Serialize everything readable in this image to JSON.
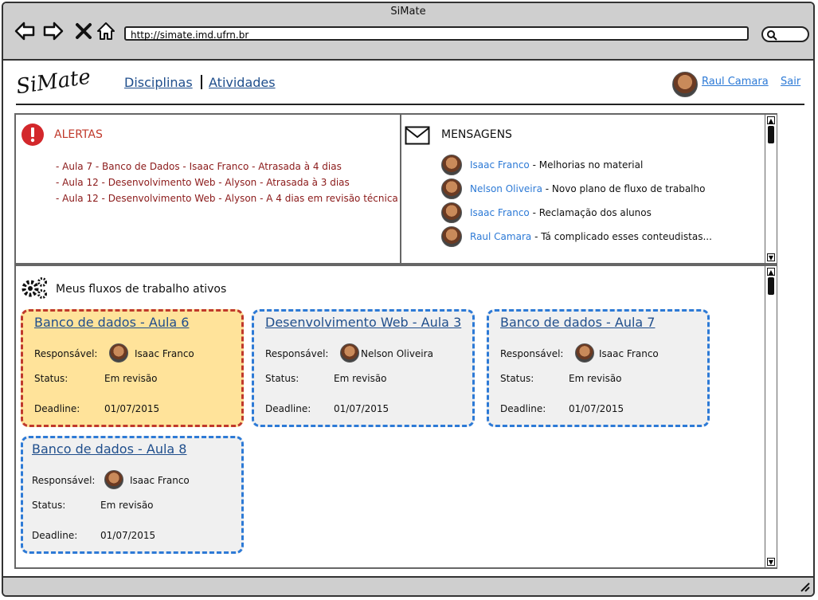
{
  "window": {
    "title": "SiMate",
    "url": "http://simate.imd.ufrn.br"
  },
  "header": {
    "logo": "SiMate",
    "nav": [
      "Disciplinas",
      "Atividades"
    ],
    "user": "Raul Camara",
    "logout": "Sair"
  },
  "alerts": {
    "title": "ALERTAS",
    "items": [
      "- Aula 7 - Banco de Dados - Isaac Franco - Atrasada à 4 dias",
      "- Aula 12 - Desenvolvimento Web - Alyson - Atrasada à 3 dias",
      "- Aula 12 - Desenvolvimento Web - Alyson - A 4 dias em revisão técnica"
    ]
  },
  "messages": {
    "title": "MENSAGENS",
    "items": [
      {
        "from": "Isaac Franco",
        "text": " - Melhorias no material"
      },
      {
        "from": "Nelson Oliveira",
        "text": " - Novo plano de fluxo de trabalho"
      },
      {
        "from": "Isaac Franco",
        "text": " - Reclamação dos alunos"
      },
      {
        "from": "Raul Camara",
        "text": " - Tá complicado esses conteudistas..."
      }
    ]
  },
  "workflows": {
    "title": "Meus fluxos de trabalho ativos",
    "labels": {
      "responsible": "Responsável:",
      "status": "Status:",
      "deadline": "Deadline:"
    },
    "cards": [
      {
        "title": "Banco de dados - Aula 6",
        "responsible": "Isaac Franco",
        "status": "Em revisão",
        "deadline": "01/07/2015",
        "highlight": true
      },
      {
        "title": "Desenvolvimento Web - Aula 3",
        "responsible": "Nelson Oliveira",
        "status": "Em revisão",
        "deadline": "01/07/2015",
        "highlight": false
      },
      {
        "title": "Banco de dados - Aula 7",
        "responsible": "Isaac Franco",
        "status": "Em revisão",
        "deadline": "01/07/2015",
        "highlight": false
      },
      {
        "title": "Banco de dados - Aula 8",
        "responsible": "Isaac Franco",
        "status": "Em revisão",
        "deadline": "01/07/2015",
        "highlight": false
      }
    ]
  },
  "colors": {
    "link": "#2d7ad6",
    "alert": "#c0392b",
    "highlight_bg": "#ffe39a",
    "card_border": "#2d7ad6"
  },
  "icons": [
    "back-icon",
    "forward-icon",
    "close-icon",
    "home-icon",
    "search-icon",
    "alert-icon",
    "mail-icon",
    "gears-icon",
    "resize-icon"
  ]
}
